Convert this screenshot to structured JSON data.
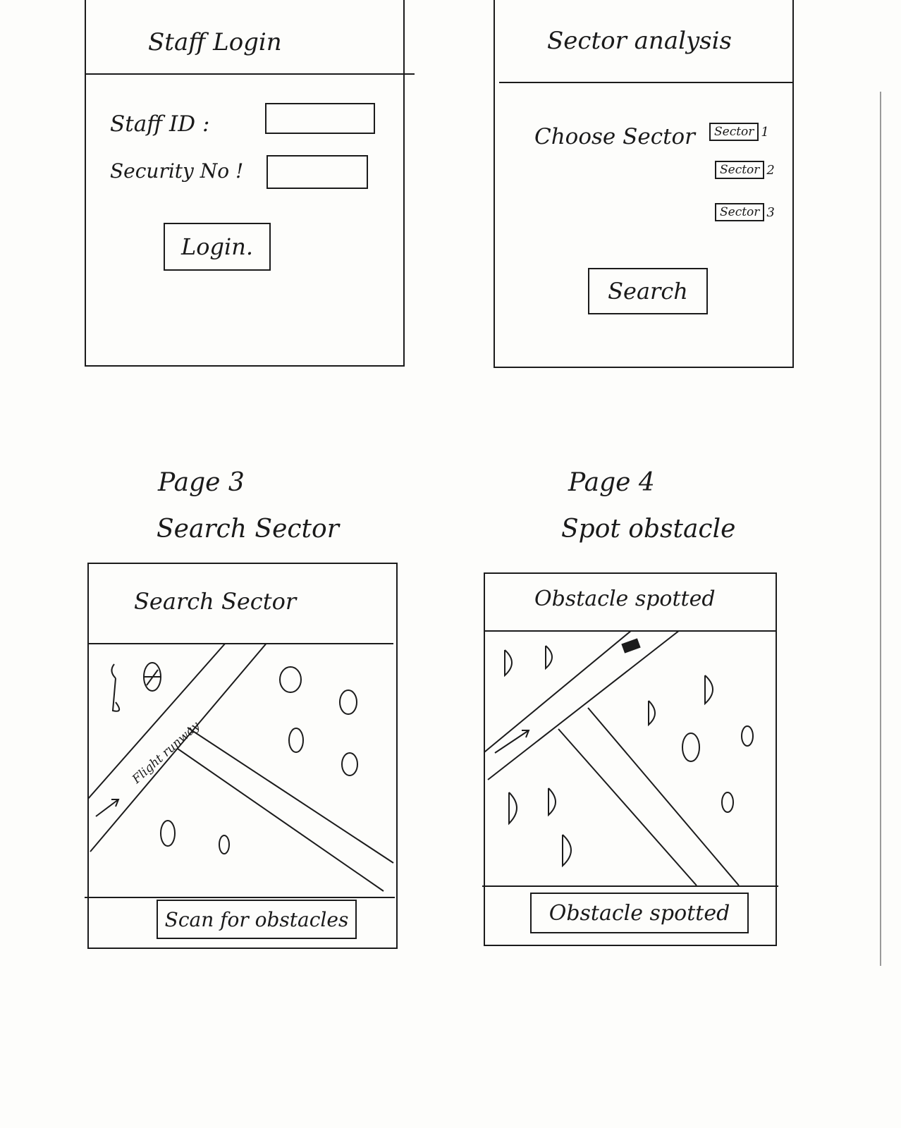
{
  "page1": {
    "title": "Staff Login",
    "staff_id_label": "Staff ID :",
    "security_no_label": "Security No !",
    "login_button": "Login."
  },
  "page2": {
    "title": "Sector analysis",
    "choose_label": "Choose Sector",
    "options": [
      {
        "label": "Sector",
        "number": "1"
      },
      {
        "label": "Sector",
        "number": "2"
      },
      {
        "label": "Sector",
        "number": "3"
      }
    ],
    "search_button": "Search"
  },
  "page3": {
    "caption_page": "Page 3",
    "caption_name": "Search Sector",
    "header": "Search Sector",
    "runway_label": "Flight runway",
    "footer_button": "Scan for obstacles"
  },
  "page4": {
    "caption_page": "Page 4",
    "caption_name": "Spot obstacle",
    "header": "Obstacle spotted",
    "footer_button": "Obstacle spotted"
  }
}
